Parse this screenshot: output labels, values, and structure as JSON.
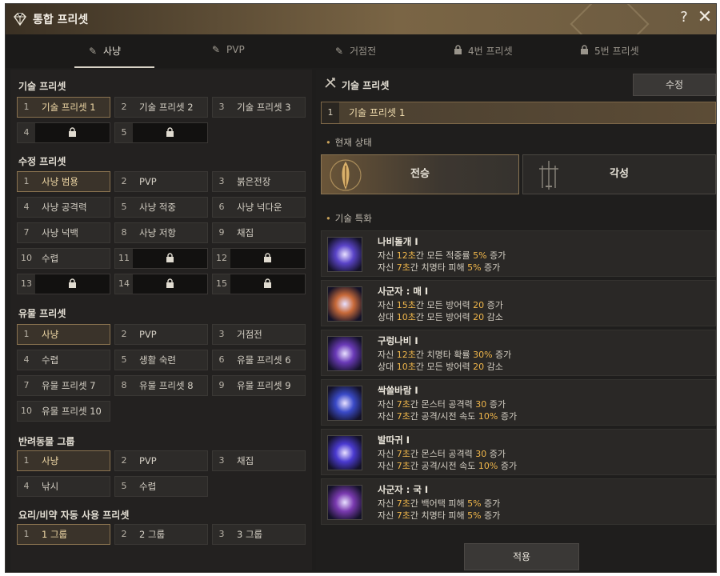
{
  "window": {
    "title": "통합 프리셋",
    "help": "?",
    "close": "✕"
  },
  "tabs": [
    {
      "label": "사냥",
      "icon": "pencil-icon",
      "active": true
    },
    {
      "label": "PVP",
      "icon": "pencil-icon",
      "active": false
    },
    {
      "label": "거점전",
      "icon": "pencil-icon",
      "active": false
    },
    {
      "label": "4번 프리셋",
      "icon": "lock-icon",
      "active": false
    },
    {
      "label": "5번 프리셋",
      "icon": "lock-icon",
      "active": false
    }
  ],
  "left": {
    "skill_presets": {
      "title": "기술 프리셋",
      "slots": [
        {
          "num": "1",
          "label": "기술 프리셋 1",
          "selected": true
        },
        {
          "num": "2",
          "label": "기술 프리셋 2"
        },
        {
          "num": "3",
          "label": "기술 프리셋 3"
        },
        {
          "num": "4",
          "locked": true
        },
        {
          "num": "5",
          "locked": true
        }
      ]
    },
    "crystal_presets": {
      "title": "수정 프리셋",
      "slots": [
        {
          "num": "1",
          "label": "사냥 범용",
          "selected": true
        },
        {
          "num": "2",
          "label": "PVP"
        },
        {
          "num": "3",
          "label": "붉은전장"
        },
        {
          "num": "4",
          "label": "사냥 공격력"
        },
        {
          "num": "5",
          "label": "사냥 적중"
        },
        {
          "num": "6",
          "label": "사냥 넉다운"
        },
        {
          "num": "7",
          "label": "사냥 넉백"
        },
        {
          "num": "8",
          "label": "사냥 저항"
        },
        {
          "num": "9",
          "label": "채집"
        },
        {
          "num": "10",
          "label": "수렵"
        },
        {
          "num": "11",
          "locked": true
        },
        {
          "num": "12",
          "locked": true
        },
        {
          "num": "13",
          "locked": true
        },
        {
          "num": "14",
          "locked": true
        },
        {
          "num": "15",
          "locked": true
        }
      ]
    },
    "relic_presets": {
      "title": "유물 프리셋",
      "slots": [
        {
          "num": "1",
          "label": "사냥",
          "selected": true
        },
        {
          "num": "2",
          "label": "PVP"
        },
        {
          "num": "3",
          "label": "거점전"
        },
        {
          "num": "4",
          "label": "수렵"
        },
        {
          "num": "5",
          "label": "생활 숙련"
        },
        {
          "num": "6",
          "label": "유물 프리셋 6"
        },
        {
          "num": "7",
          "label": "유물 프리셋 7"
        },
        {
          "num": "8",
          "label": "유물 프리셋 8"
        },
        {
          "num": "9",
          "label": "유물 프리셋 9"
        },
        {
          "num": "10",
          "label": "유물 프리셋 10"
        }
      ]
    },
    "pet_groups": {
      "title": "반려동물 그룹",
      "slots": [
        {
          "num": "1",
          "label": "사냥",
          "selected": true
        },
        {
          "num": "2",
          "label": "PVP"
        },
        {
          "num": "3",
          "label": "채집"
        },
        {
          "num": "4",
          "label": "낚시"
        },
        {
          "num": "5",
          "label": "수렵"
        }
      ]
    },
    "food_presets": {
      "title": "요리/비약 자동 사용 프리셋",
      "slots": [
        {
          "num": "1",
          "label": "1 그룹",
          "selected": true
        },
        {
          "num": "2",
          "label": "2 그룹"
        },
        {
          "num": "3",
          "label": "3 그룹"
        }
      ]
    }
  },
  "right": {
    "header": "기술 프리셋",
    "edit_label": "수정",
    "current_preset": {
      "num": "1",
      "label": "기술 프리셋 1"
    },
    "state_title": "현재 상태",
    "states": [
      {
        "label": "전승",
        "selected": true
      },
      {
        "label": "각성",
        "selected": false
      }
    ],
    "skills_title": "기술 특화",
    "skills": [
      {
        "name": "나비돌개 I",
        "icon_color": "#5a44c8",
        "l1": [
          "자신 ",
          "12초",
          "간 모든 적중률 ",
          "5%",
          " 증가"
        ],
        "l2": [
          "자신 ",
          "7초",
          "간 치명타 피해 ",
          "5%",
          " 증가"
        ]
      },
      {
        "name": "사군자 : 매 I",
        "icon_color": "#c86a3a",
        "l1": [
          "자신 ",
          "15초",
          "간 모든 방어력 ",
          "20",
          " 증가"
        ],
        "l2": [
          "상대 ",
          "10초",
          "간 모든 방어력 ",
          "20",
          " 감소"
        ]
      },
      {
        "name": "구렁나비 I",
        "icon_color": "#6a3ab8",
        "l1": [
          "자신 ",
          "12초",
          "간 치명타 확률 ",
          "30%",
          " 증가"
        ],
        "l2": [
          "상대 ",
          "10초",
          "간 모든 방어력 ",
          "20",
          " 감소"
        ]
      },
      {
        "name": "싹쓸바람 I",
        "icon_color": "#3a4ac8",
        "l1": [
          "자신 ",
          "7초",
          "간 몬스터 공격력 ",
          "30",
          " 증가"
        ],
        "l2": [
          "자신 ",
          "7초",
          "간 공격/시전 속도 ",
          "10%",
          " 증가"
        ]
      },
      {
        "name": "발따귀 I",
        "icon_color": "#4a3ad0",
        "l1": [
          "자신 ",
          "7초",
          "간 몬스터 공격력 ",
          "30",
          " 증가"
        ],
        "l2": [
          "자신 ",
          "7초",
          "간 공격/시전 속도 ",
          "10%",
          " 증가"
        ]
      },
      {
        "name": "사군자 : 국 I",
        "icon_color": "#7a3ab0",
        "l1": [
          "자신 ",
          "7초",
          "간 백어택 피해 ",
          "5%",
          " 증가"
        ],
        "l2": [
          "자신 ",
          "7초",
          "간 치명타 피해 ",
          "5%",
          " 증가"
        ]
      }
    ],
    "apply_label": "적용"
  },
  "colors": {
    "highlight": "#f0b64a",
    "selected_border": "#8a7350",
    "title_gold": "#7a6545"
  }
}
